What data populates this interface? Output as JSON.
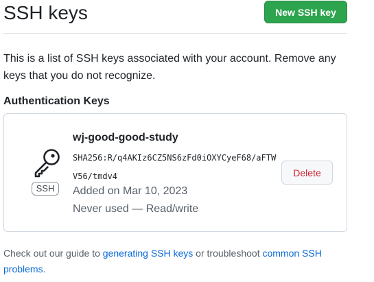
{
  "header": {
    "title": "SSH keys",
    "new_key_button": "New SSH key"
  },
  "intro": {
    "text": "This is a list of SSH keys associated with your account. Remove any keys that you do not recognize."
  },
  "auth_section": {
    "heading": "Authentication Keys"
  },
  "keys": [
    {
      "title": "wj-good-good-study",
      "fingerprint": "SHA256:R/q4AKIz6CZ5NS6zFd0iOXYCyeF68/aFTWV56/tmdv4",
      "type_badge": "SSH",
      "added": "Added on Mar 10, 2023",
      "usage": "Never used — Read/write",
      "delete_label": "Delete",
      "icon": "key-icon"
    }
  ],
  "footer": {
    "prefix": "Check out our guide to ",
    "link_generating": "generating SSH keys",
    "middle": " or troubleshoot ",
    "link_common": "common SSH problems",
    "suffix": "."
  },
  "colors": {
    "primary_button": "#2da44e",
    "danger_text": "#cf222e",
    "link": "#0969da",
    "muted_text": "#57606a",
    "border": "#d0d7de"
  }
}
